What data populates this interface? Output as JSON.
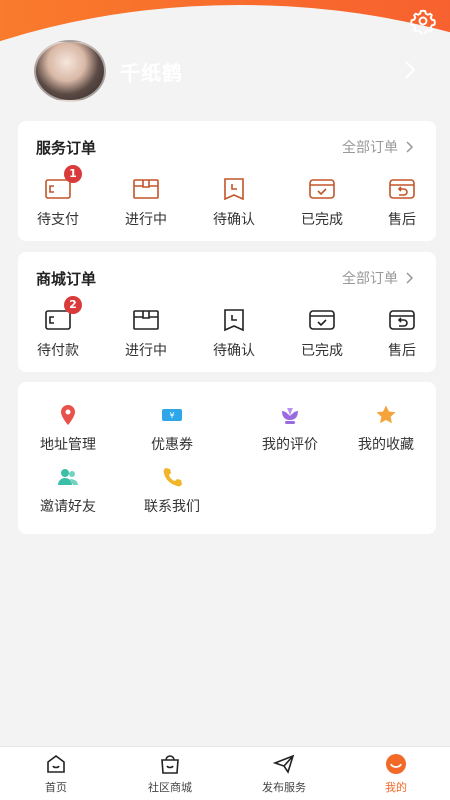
{
  "profile": {
    "username": "千纸鹤"
  },
  "service_orders": {
    "title": "服务订单",
    "more_label": "全部订单",
    "items": [
      {
        "label": "待支付",
        "icon": "wallet-icon",
        "badge": "1"
      },
      {
        "label": "进行中",
        "icon": "box-icon",
        "badge": ""
      },
      {
        "label": "待确认",
        "icon": "clock-bookmark-icon",
        "badge": ""
      },
      {
        "label": "已完成",
        "icon": "check-box-icon",
        "badge": ""
      },
      {
        "label": "售后",
        "icon": "return-icon",
        "badge": ""
      }
    ]
  },
  "mall_orders": {
    "title": "商城订单",
    "more_label": "全部订单",
    "items": [
      {
        "label": "待付款",
        "icon": "wallet-icon",
        "badge": "2"
      },
      {
        "label": "进行中",
        "icon": "box-icon",
        "badge": ""
      },
      {
        "label": "待确认",
        "icon": "clock-bookmark-icon",
        "badge": ""
      },
      {
        "label": "已完成",
        "icon": "check-box-icon",
        "badge": ""
      },
      {
        "label": "售后",
        "icon": "return-icon",
        "badge": ""
      }
    ]
  },
  "tools": [
    {
      "label": "地址管理",
      "icon": "location-pin-icon",
      "color": "#e9524a"
    },
    {
      "label": "优惠券",
      "icon": "coupon-icon",
      "color": "#2fa6e8"
    },
    {
      "label": "我的评价",
      "icon": "flower-icon",
      "color": "#9a6be0"
    },
    {
      "label": "我的收藏",
      "icon": "star-icon",
      "color": "#f4a43a"
    },
    {
      "label": "邀请好友",
      "icon": "users-icon",
      "color": "#3cbfa8"
    },
    {
      "label": "联系我们",
      "icon": "phone-icon",
      "color": "#f2b52a"
    }
  ],
  "tabbar": [
    {
      "label": "首页",
      "icon": "home-icon",
      "active": false
    },
    {
      "label": "社区商城",
      "icon": "shop-bag-icon",
      "active": false
    },
    {
      "label": "发布服务",
      "icon": "send-icon",
      "active": false
    },
    {
      "label": "我的",
      "icon": "smile-icon",
      "active": true
    }
  ],
  "colors": {
    "brand": "#f86a2d",
    "badge": "#d93a3a",
    "active_tab": "#f26a28"
  }
}
